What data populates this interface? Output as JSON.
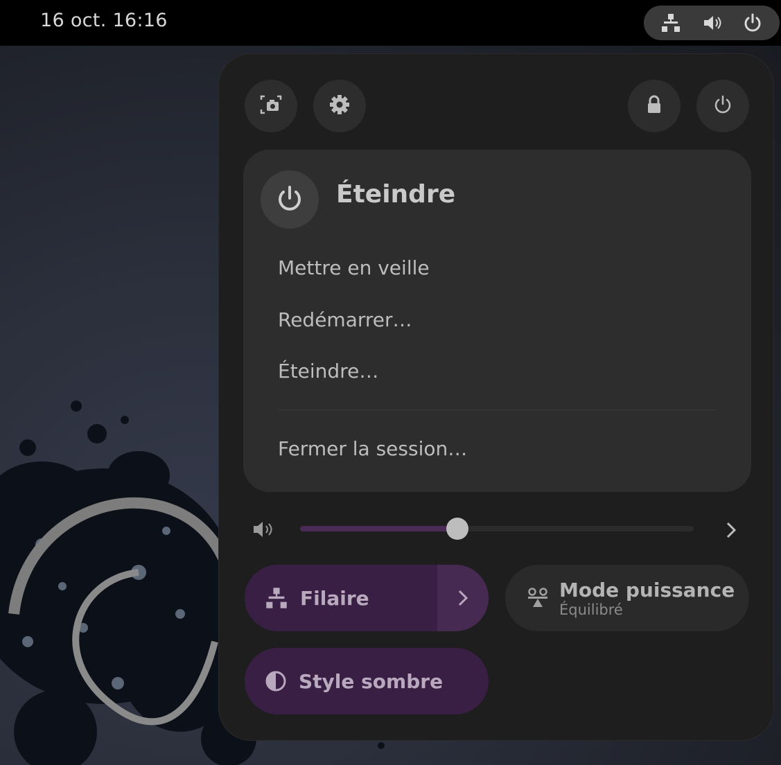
{
  "topbar": {
    "clock": "16 oct.  16:16",
    "status_icons": [
      "network-wired-icon",
      "volume-icon",
      "power-icon"
    ]
  },
  "panel": {
    "header_buttons": [
      "screenshot-icon",
      "gear-icon",
      "lock-icon",
      "power-icon"
    ],
    "power_menu": {
      "title": "Éteindre",
      "items": [
        "Mettre en veille",
        "Redémarrer…",
        "Éteindre…"
      ],
      "session_item": "Fermer la session…"
    },
    "volume": {
      "level": 0.4
    },
    "toggles": {
      "wired": {
        "label": "Filaire",
        "active": true
      },
      "power_mode": {
        "label": "Mode puissance",
        "subtitle": "Équilibré",
        "active": false
      },
      "dark_style": {
        "label": "Style sombre",
        "active": true
      }
    }
  },
  "colors": {
    "panel_bg": "#1e1e1e",
    "card_bg": "#2d2d2d",
    "accent_active": "#3a1f45",
    "topbar_bg": "#000000"
  }
}
